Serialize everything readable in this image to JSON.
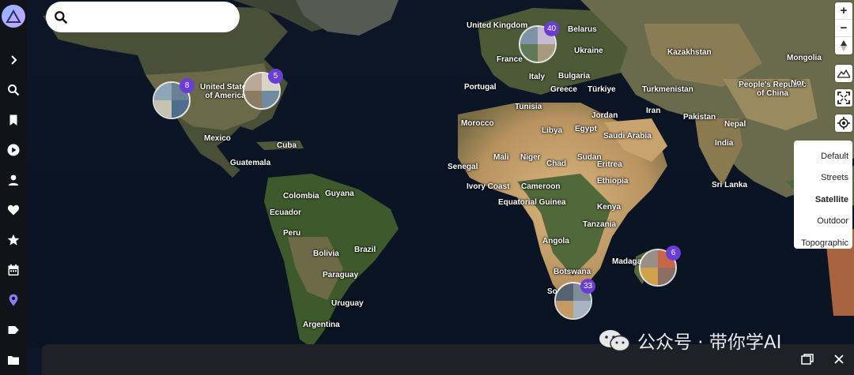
{
  "search": {
    "placeholder": ""
  },
  "sidebar": {
    "items": [
      {
        "icon": "chevron-right-icon"
      },
      {
        "icon": "search-icon"
      },
      {
        "icon": "bookmark-icon"
      },
      {
        "icon": "play-icon"
      },
      {
        "icon": "person-icon"
      },
      {
        "icon": "heart-icon"
      },
      {
        "icon": "star-icon"
      },
      {
        "icon": "calendar-icon"
      },
      {
        "icon": "map-pin-icon",
        "active": true
      },
      {
        "icon": "tag-icon"
      },
      {
        "icon": "folder-icon"
      }
    ],
    "active_color": "#8b7cf6"
  },
  "map": {
    "labels": [
      {
        "id": "united-kingdom",
        "text": "United Kingdom"
      },
      {
        "id": "belarus",
        "text": "Belarus"
      },
      {
        "id": "kazakhstan",
        "text": "Kazakhstan"
      },
      {
        "id": "mongolia",
        "text": "Mongolia"
      },
      {
        "id": "ukraine",
        "text": "Ukraine"
      },
      {
        "id": "france",
        "text": "France"
      },
      {
        "id": "united-states",
        "text": "United States of America"
      },
      {
        "id": "portugal",
        "text": "Portugal"
      },
      {
        "id": "italy",
        "text": "Italy"
      },
      {
        "id": "bulgaria",
        "text": "Bulgaria"
      },
      {
        "id": "greece",
        "text": "Greece"
      },
      {
        "id": "turkiye",
        "text": "Türkiye"
      },
      {
        "id": "turkmenistan",
        "text": "Turkmenistan"
      },
      {
        "id": "china",
        "text": "People's Republic of China"
      },
      {
        "id": "tunisia",
        "text": "Tunisia"
      },
      {
        "id": "iran",
        "text": "Iran"
      },
      {
        "id": "jordan",
        "text": "Jordan"
      },
      {
        "id": "pakistan",
        "text": "Pakistan"
      },
      {
        "id": "morocco",
        "text": "Morocco"
      },
      {
        "id": "libya",
        "text": "Libya"
      },
      {
        "id": "egypt",
        "text": "Egypt"
      },
      {
        "id": "nepal",
        "text": "Nepal"
      },
      {
        "id": "mexico",
        "text": "Mexico"
      },
      {
        "id": "saudi-arabia",
        "text": "Saudi Arabia"
      },
      {
        "id": "india",
        "text": "India"
      },
      {
        "id": "cuba",
        "text": "Cuba"
      },
      {
        "id": "mali",
        "text": "Mali"
      },
      {
        "id": "niger",
        "text": "Niger"
      },
      {
        "id": "sudan",
        "text": "Sudan"
      },
      {
        "id": "guatemala",
        "text": "Guatemala"
      },
      {
        "id": "senegal",
        "text": "Senegal"
      },
      {
        "id": "chad",
        "text": "Chad"
      },
      {
        "id": "eritrea",
        "text": "Eritrea"
      },
      {
        "id": "ethiopia",
        "text": "Ethiopia"
      },
      {
        "id": "ivory-coast",
        "text": "Ivory Coast"
      },
      {
        "id": "cameroon",
        "text": "Cameroon"
      },
      {
        "id": "sri-lanka",
        "text": "Sri Lanka"
      },
      {
        "id": "colombia",
        "text": "Colombia"
      },
      {
        "id": "guyana",
        "text": "Guyana"
      },
      {
        "id": "equatorial-guinea",
        "text": "Equatorial Guinea"
      },
      {
        "id": "ecuador",
        "text": "Ecuador"
      },
      {
        "id": "kenya",
        "text": "Kenya"
      },
      {
        "id": "tanzania",
        "text": "Tanzania"
      },
      {
        "id": "peru",
        "text": "Peru"
      },
      {
        "id": "angola",
        "text": "Angola"
      },
      {
        "id": "brazil",
        "text": "Brazil"
      },
      {
        "id": "bolivia",
        "text": "Bolivia"
      },
      {
        "id": "madagascar",
        "text": "Madaga"
      },
      {
        "id": "botswana",
        "text": "Botswana"
      },
      {
        "id": "paraguay",
        "text": "Paraguay"
      },
      {
        "id": "uruguay",
        "text": "Uruguay"
      },
      {
        "id": "south-africa",
        "text": "So"
      },
      {
        "id": "argentina",
        "text": "Argentina"
      },
      {
        "id": "nor",
        "text": "Nor"
      }
    ],
    "clusters": [
      {
        "id": "us-west",
        "count": "8"
      },
      {
        "id": "us-east",
        "count": "5"
      },
      {
        "id": "europe",
        "count": "40"
      },
      {
        "id": "madagascar",
        "count": "6"
      },
      {
        "id": "south-africa",
        "count": "33"
      }
    ]
  },
  "controls": {
    "zoom_in": "+",
    "zoom_out": "−"
  },
  "layers": {
    "options": [
      "Default",
      "Streets",
      "Satellite",
      "Outdoor",
      "Topographic"
    ],
    "selected": "Satellite"
  },
  "watermark": {
    "text": "公众号 · 带你学AI"
  }
}
